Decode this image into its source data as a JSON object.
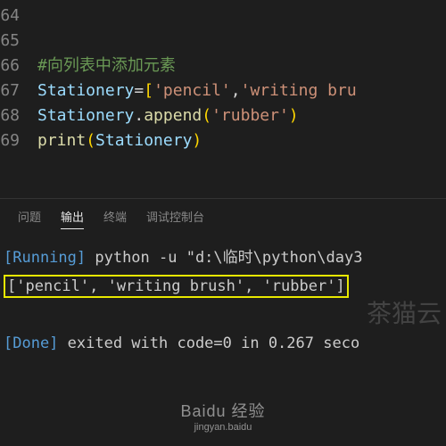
{
  "editor": {
    "lines": [
      {
        "num": "64",
        "segments": []
      },
      {
        "num": "65",
        "segments": []
      },
      {
        "num": "66",
        "segments": [
          {
            "cls": "comment",
            "t": "#向列表中添加元素"
          }
        ]
      },
      {
        "num": "67",
        "segments": [
          {
            "cls": "variable",
            "t": "Stationery"
          },
          {
            "cls": "operator",
            "t": "="
          },
          {
            "cls": "bracket",
            "t": "["
          },
          {
            "cls": "string",
            "t": "'pencil'"
          },
          {
            "cls": "punct",
            "t": ","
          },
          {
            "cls": "string",
            "t": "'writing bru"
          }
        ]
      },
      {
        "num": "68",
        "segments": [
          {
            "cls": "variable",
            "t": "Stationery"
          },
          {
            "cls": "punct",
            "t": "."
          },
          {
            "cls": "function",
            "t": "append"
          },
          {
            "cls": "bracket",
            "t": "("
          },
          {
            "cls": "string",
            "t": "'rubber'"
          },
          {
            "cls": "bracket",
            "t": ")"
          }
        ]
      },
      {
        "num": "69",
        "segments": [
          {
            "cls": "builtin",
            "t": "print"
          },
          {
            "cls": "bracket",
            "t": "("
          },
          {
            "cls": "variable",
            "t": "Stationery"
          },
          {
            "cls": "bracket",
            "t": ")"
          }
        ]
      }
    ]
  },
  "panel": {
    "tabs": [
      {
        "label": "问题",
        "active": false
      },
      {
        "label": "输出",
        "active": true
      },
      {
        "label": "终端",
        "active": false
      },
      {
        "label": "调试控制台",
        "active": false
      }
    ]
  },
  "output": {
    "running_label": "[Running]",
    "running_text": " python -u \"d:\\临时\\python\\day3",
    "result": "['pencil', 'writing brush', 'rubber']",
    "done_label": "[Done]",
    "done_text": " exited with code=0 in 0.267 seco"
  },
  "watermark": {
    "side": "茶猫云",
    "logo": "Baidu 经验",
    "sub": "jingyan.baidu"
  }
}
